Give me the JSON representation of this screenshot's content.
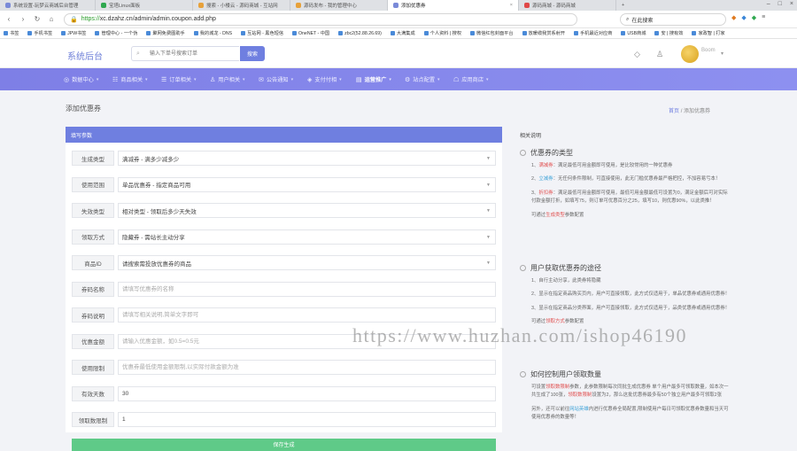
{
  "browser": {
    "tabs": [
      {
        "label": "系统设置-玩梦云商城后台管理",
        "active": false
      },
      {
        "label": "宝塔Linux面板",
        "active": false
      },
      {
        "label": "搜索 - 小楼云 - 源码商城 - 互站网",
        "active": false
      },
      {
        "label": "源码发布 - 我的管理中心",
        "active": false
      },
      {
        "label": "添加优惠券",
        "active": true
      },
      {
        "label": "源码商城 - 源码商城",
        "active": false
      }
    ],
    "url_scheme": "https://",
    "url_rest": "xc.dzahz.cn/admin/admin.coupon.add.php",
    "search_text": "在此搜索",
    "bookmarks": [
      "书签",
      "手机书签",
      "JPW书签",
      "管理中心 - 一个伪",
      "聚网免费图助手",
      "我的城龙 - DNS",
      "互站网 - 黑色短信",
      "OneNET - 中国",
      "zbc2(52.88.26.69)",
      "大满集成",
      "个人资料 | 搜权",
      "微信红包封面平台",
      "放暖缆我赏系射开",
      "手机最近对应商",
      "USB商城",
      "安 | 搜有效",
      "家政智 | 打家"
    ]
  },
  "header": {
    "logo": "系统后台",
    "search_placeholder": "输入下单号搜索订单",
    "search_button": "搜索",
    "user_name": "Boom"
  },
  "menu": [
    {
      "label": "数据中心",
      "icon": "◎"
    },
    {
      "label": "商品相关",
      "icon": "☷"
    },
    {
      "label": "订单相关",
      "icon": "☰"
    },
    {
      "label": "用户相关",
      "icon": "♙"
    },
    {
      "label": "公告通知",
      "icon": "✉"
    },
    {
      "label": "支付付相",
      "icon": "◈"
    },
    {
      "label": "运营推广",
      "icon": "▤"
    },
    {
      "label": "站点配置",
      "icon": "⚙"
    },
    {
      "label": "应用商店",
      "icon": "☖"
    }
  ],
  "page": {
    "title": "添加优惠券",
    "breadcrumb_home": "首页",
    "breadcrumb_sep": "/",
    "breadcrumb_current": "添加优惠券"
  },
  "form": {
    "panel_title": "填写参数",
    "fields": [
      {
        "label": "生成类型",
        "value": "满减券 - 满多少减多少",
        "type": "select"
      },
      {
        "label": "使用范围",
        "value": "单品优惠券 - 指定商品可用",
        "type": "select"
      },
      {
        "label": "失效类型",
        "value": "相对类型 - 领取后多少天失效",
        "type": "select"
      },
      {
        "label": "领取方式",
        "value": "隐藏券 - 需站长主动分享",
        "type": "select"
      },
      {
        "label": "商品ID",
        "value": "请搜索需投放优惠券的商品",
        "type": "select"
      },
      {
        "label": "券码名称",
        "placeholder": "请填写优惠券的名称",
        "value": "",
        "type": "input"
      },
      {
        "label": "券码说明",
        "placeholder": "请填写相关说明,简单文字即可",
        "value": "",
        "type": "input"
      },
      {
        "label": "优惠金额",
        "placeholder": "请输入优惠金额，如0.5=0.5元",
        "value": "",
        "type": "input"
      },
      {
        "label": "使用限制",
        "placeholder": "优惠券最低使用金额限制,以实际付款金额为准",
        "value": "",
        "type": "input"
      },
      {
        "label": "有效天数",
        "placeholder": "",
        "value": "30",
        "type": "input"
      },
      {
        "label": "领取数限制",
        "placeholder": "",
        "value": "1",
        "type": "input"
      }
    ],
    "submit_label": "保存生成"
  },
  "help": {
    "title": "相关说明",
    "s1_title": "优惠券的类型",
    "s1_p1a": "1、",
    "s1_p1b": "满减券",
    "s1_p1c": "：满足最低可用金额即可使用，是比较常用的一种优惠券",
    "s1_p2a": "2、",
    "s1_p2b": "立减券",
    "s1_p2c": "：无任何条件限制，可直接使用，此无门槛优惠券最严格把控，不加容易亏本！",
    "s1_p3a": "3、",
    "s1_p3b": "折扣券",
    "s1_p3c": "：满足最低可用金额即可使用，最低可用金额最低可设置为0，满足金额后可对实际付款金额打折，如填写75，则订单可优惠百分之25，填写10，则优惠90%，以此类推！",
    "s1_p4a": "可通过",
    "s1_p4b": "生成类型",
    "s1_p4c": "参数配置",
    "s2_title": "用户获取优惠券的途径",
    "s2_p1": "1、自行主动分享，此类券将隐藏",
    "s2_p2": "2、显示在指定商品购买页内，用户可直接领取，此方式仅适用于，单品优惠券或通用优惠券！",
    "s2_p3": "3、显示在指定商品分类界面，用户可直接领取，此方式仅适用于，品类优惠券或通用优惠券！",
    "s2_p4a": "可通过",
    "s2_p4b": "领取方式",
    "s2_p4c": "参数配置",
    "s3_title": "如何控制用户领取数量",
    "s3_p1a": "可设置",
    "s3_p1b": "领取数限制",
    "s3_p1c": "参数，此参数限制每次同批生成优惠券 单个用户最多可领取数量，如本次一共生成了100张，",
    "s3_p1d": "领取数限制",
    "s3_p1e": "设置为2，那么这批优惠券最多有50个独立用户最多可领取2张",
    "s3_p2a": "另外，还可以前往",
    "s3_p2b": "网站英雄",
    "s3_p2c": "内进行优惠券全局配置,限制使用户每日可领取优惠券数量和当天可使用优惠券的数量等！"
  },
  "watermark": "https://www.huzhan.com/ishop46190"
}
